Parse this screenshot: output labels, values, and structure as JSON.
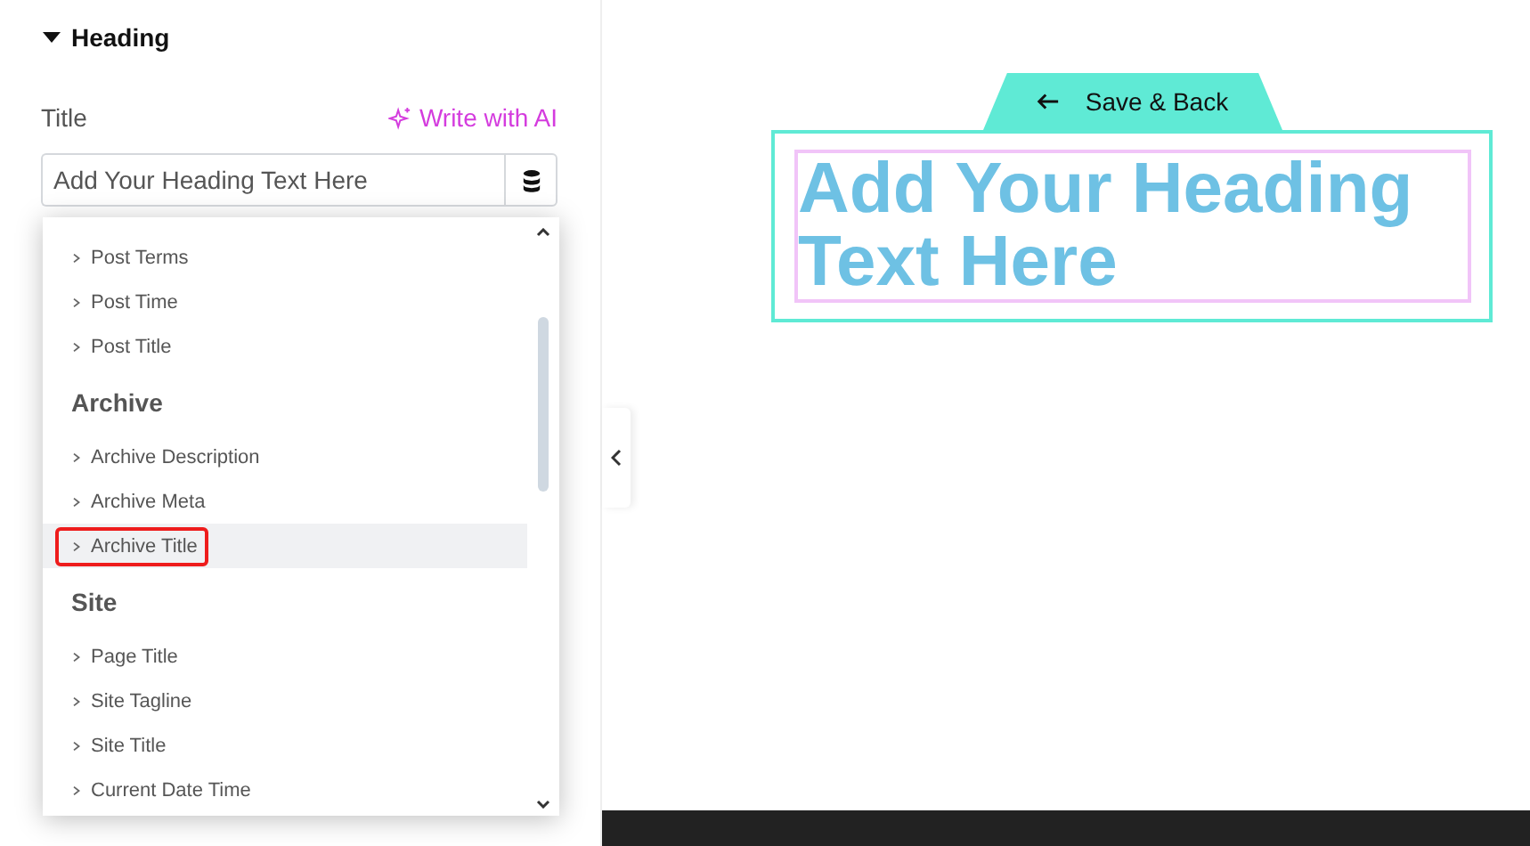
{
  "section": {
    "title": "Heading",
    "expanded": true
  },
  "title_field": {
    "label": "Title",
    "ai_link": "Write with AI",
    "placeholder": "Add Your Heading Text Here"
  },
  "dropdown": {
    "entries": [
      {
        "kind": "option",
        "label": "Post Terms",
        "selected": false
      },
      {
        "kind": "option",
        "label": "Post Time",
        "selected": false
      },
      {
        "kind": "option",
        "label": "Post Title",
        "selected": false
      },
      {
        "kind": "heading",
        "label": "Archive"
      },
      {
        "kind": "option",
        "label": "Archive Description",
        "selected": false
      },
      {
        "kind": "option",
        "label": "Archive Meta",
        "selected": false
      },
      {
        "kind": "option",
        "label": "Archive Title",
        "selected": true
      },
      {
        "kind": "heading",
        "label": "Site"
      },
      {
        "kind": "option",
        "label": "Page Title",
        "selected": false
      },
      {
        "kind": "option",
        "label": "Site Tagline",
        "selected": false
      },
      {
        "kind": "option",
        "label": "Site Title",
        "selected": false
      },
      {
        "kind": "option",
        "label": "Current Date Time",
        "selected": false
      }
    ]
  },
  "preview": {
    "save_back": "Save & Back",
    "heading": "Add Your Heading Text Here"
  }
}
